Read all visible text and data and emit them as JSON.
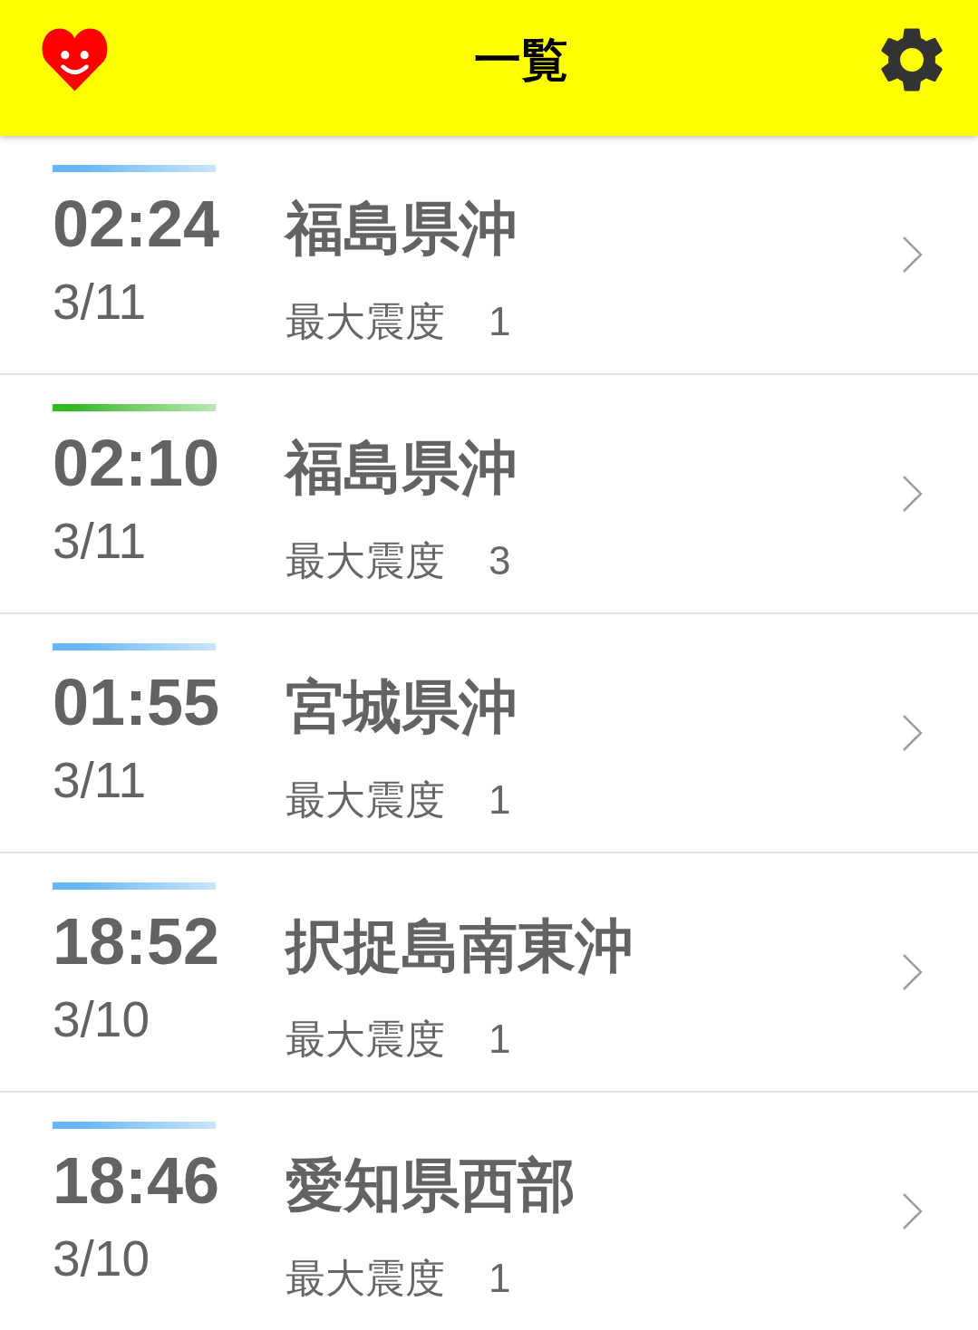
{
  "header": {
    "title": "一覧"
  },
  "events": [
    {
      "time": "02:24",
      "date": "3/11",
      "place": "福島県沖",
      "intensity_label": "最大震度",
      "intensity": "1",
      "color": "#64b5f6"
    },
    {
      "time": "02:10",
      "date": "3/11",
      "place": "福島県沖",
      "intensity_label": "最大震度",
      "intensity": "3",
      "color": "#33bb22"
    },
    {
      "time": "01:55",
      "date": "3/11",
      "place": "宮城県沖",
      "intensity_label": "最大震度",
      "intensity": "1",
      "color": "#64b5f6"
    },
    {
      "time": "18:52",
      "date": "3/10",
      "place": "択捉島南東沖",
      "intensity_label": "最大震度",
      "intensity": "1",
      "color": "#64b5f6"
    },
    {
      "time": "18:46",
      "date": "3/10",
      "place": "愛知県西部",
      "intensity_label": "最大震度",
      "intensity": "1",
      "color": "#64b5f6"
    }
  ]
}
